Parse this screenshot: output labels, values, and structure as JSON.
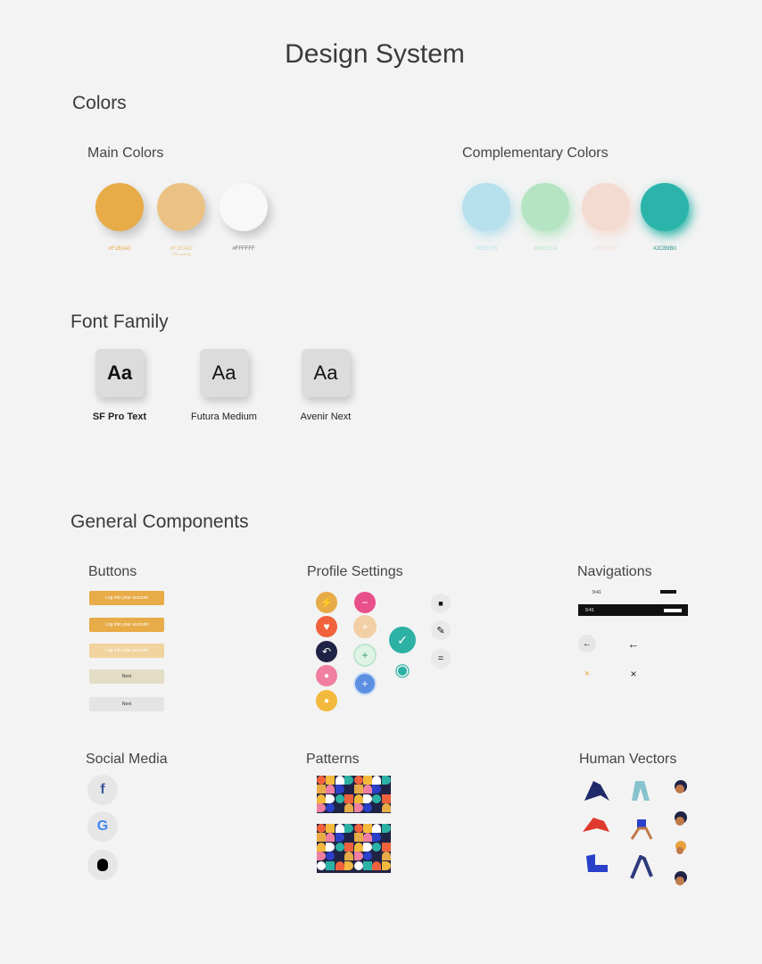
{
  "page_title": "Design System",
  "colors": {
    "heading": "Colors",
    "main": {
      "heading": "Main Colors",
      "swatches": [
        {
          "hex": "#F1B34D",
          "color": "#e7ab47",
          "note": ""
        },
        {
          "hex": "#F1B34D",
          "color": "#ebc283",
          "note": "70% opacity"
        },
        {
          "hex": "#FFFFFF",
          "color": "#f8f8f8",
          "note": ""
        }
      ]
    },
    "complementary": {
      "heading": "Complementary Colors",
      "swatches": [
        {
          "hex": "#B5E1F5",
          "color": "#b6e0ec"
        },
        {
          "hex": "#B8E0C4",
          "color": "#b5e4c3"
        },
        {
          "hex": "#F3D4C9",
          "color": "#f4dbd2"
        },
        {
          "hex": "#2CB9B0",
          "color": "#2bb4a9"
        }
      ]
    }
  },
  "fonts": {
    "heading": "Font Family",
    "items": [
      {
        "sample": "Aa",
        "name": "SF Pro Text"
      },
      {
        "sample": "Aa",
        "name": "Futura Medium"
      },
      {
        "sample": "Aa",
        "name": "Avenir Next"
      }
    ]
  },
  "components": {
    "heading": "General Components",
    "buttons": {
      "heading": "Buttons",
      "items": [
        {
          "label": "Log into your account",
          "color": "#e7ab47",
          "text_color": "#ffffff"
        },
        {
          "label": "Log into your account",
          "color": "#e7ab47",
          "text_color": "#ffffff"
        },
        {
          "label": "Log into your account",
          "color": "#f1d3a0",
          "text_color": "#ffffff"
        },
        {
          "label": "Next",
          "color": "#e3ddc6",
          "text_color": "#333333"
        },
        {
          "label": "Next",
          "color": "#e4e4e4",
          "text_color": "#333333"
        }
      ]
    },
    "profile": {
      "heading": "Profile Settings",
      "icons": {
        "bolt": "⚡",
        "heart": "♥",
        "back": "↶",
        "circle": "●",
        "user": "●",
        "minus": "−",
        "plus": "+",
        "check": "✓",
        "eye": "◉",
        "bag": "■",
        "edit": "✎",
        "menu": "="
      }
    },
    "navigation": {
      "heading": "Navigations",
      "status_time": "9:41",
      "back_arrow": "←",
      "close": "×"
    },
    "social": {
      "heading": "Social Media",
      "items": [
        {
          "name": "facebook-icon",
          "glyph": "f",
          "color": "#3b5998"
        },
        {
          "name": "google-icon",
          "glyph": "G",
          "color": "#4285f4"
        },
        {
          "name": "apple-icon",
          "glyph": "",
          "color": "#000000"
        }
      ]
    },
    "patterns": {
      "heading": "Patterns"
    },
    "humans": {
      "heading": "Human Vectors"
    }
  }
}
